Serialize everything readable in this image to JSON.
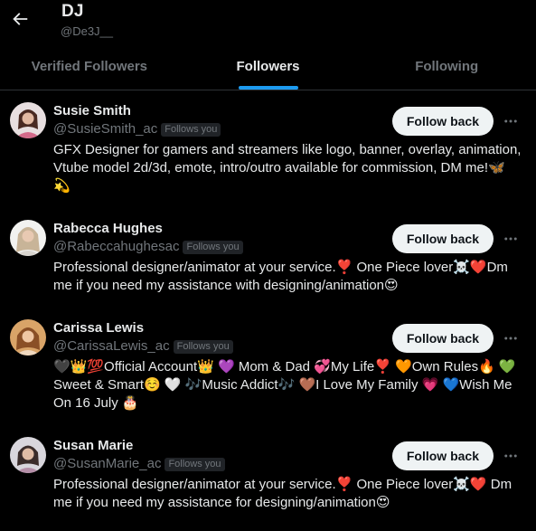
{
  "header": {
    "title": "DJ",
    "handle": "@De3J__"
  },
  "tabs": [
    {
      "label": "Verified Followers",
      "active": false
    },
    {
      "label": "Followers",
      "active": true
    },
    {
      "label": "Following",
      "active": false
    }
  ],
  "colors": {
    "accent": "#1d9bf0",
    "background": "#000000",
    "secondary_text": "#71767b",
    "button_bg": "#eff3f4"
  },
  "users": [
    {
      "name": "Susie Smith",
      "username": "@SusieSmith_ac",
      "badge": "Follows you",
      "button": "Follow back",
      "bio": "GFX Designer for gamers and streamers like logo, banner, overlay, animation, Vtube model 2d/3d, emote, intro/outro available for commission, DM me!🦋 💫"
    },
    {
      "name": "Rabecca Hughes",
      "username": "@Rabeccahughesac",
      "badge": "Follows you",
      "button": "Follow back",
      "bio": "Professional designer/animator at your service.❣️ One Piece lover☠️❤️Dm me if you need my assistance with designing/animation😍"
    },
    {
      "name": "Carissa Lewis",
      "username": "@CarissaLewis_ac",
      "badge": "Follows you",
      "button": "Follow back",
      "bio": "🖤👑💯Official Account👑 💜 Mom & Dad 💞My Life❣️ 🧡Own Rules🔥 💚Sweet & Smart☺️ 🤍 🎶Music Addict🎶 🤎I Love My Family 💗 💙Wish Me On 16 July 🎂"
    },
    {
      "name": "Susan Marie",
      "username": "@SusanMarie_ac",
      "badge": "Follows you",
      "button": "Follow back",
      "bio": "Professional designer/animator at your service.❣️ One Piece lover☠️❤️ Dm me if you need my assistance for designing/animation😍"
    }
  ]
}
